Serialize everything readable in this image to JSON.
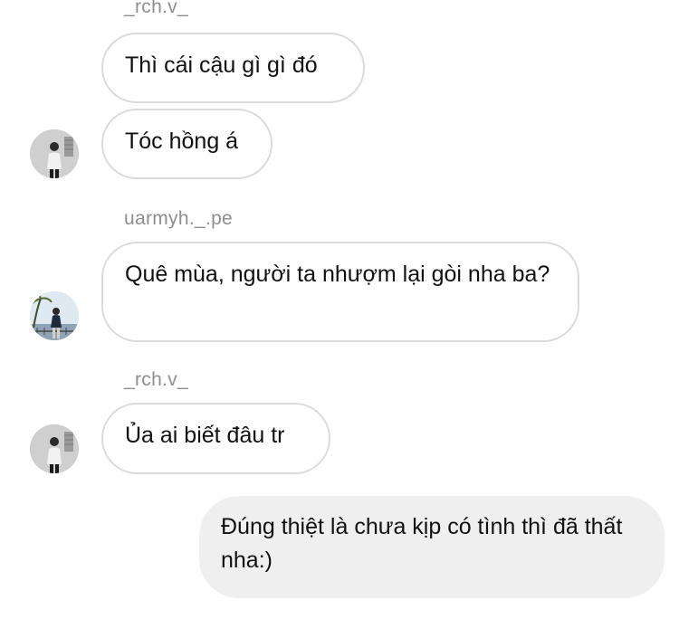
{
  "conversation": {
    "usernames": [
      "_rch.v_",
      "uarmyh._.pe",
      "_rch.v_"
    ],
    "messages": [
      {
        "sender": "_rch.v_",
        "text": "Thì cái cậu gì gì đó",
        "direction": "incoming"
      },
      {
        "sender": "_rch.v_",
        "text": "Tóc hồng á",
        "direction": "incoming"
      },
      {
        "sender": "uarmyh._.pe",
        "text": "Quê mùa, người ta nhượm lại gòi nha ba?",
        "direction": "incoming"
      },
      {
        "sender": "_rch.v_",
        "text": "Ủa ai biết đâu tr",
        "direction": "incoming"
      },
      {
        "sender": "me",
        "text": "Đúng thiệt là chưa kịp có tình thì đã thất nha:)",
        "direction": "outgoing"
      }
    ]
  },
  "colors": {
    "incoming_border": "#dbdbdb",
    "outgoing_background": "#efefef",
    "username_text": "#8e8e8e"
  }
}
